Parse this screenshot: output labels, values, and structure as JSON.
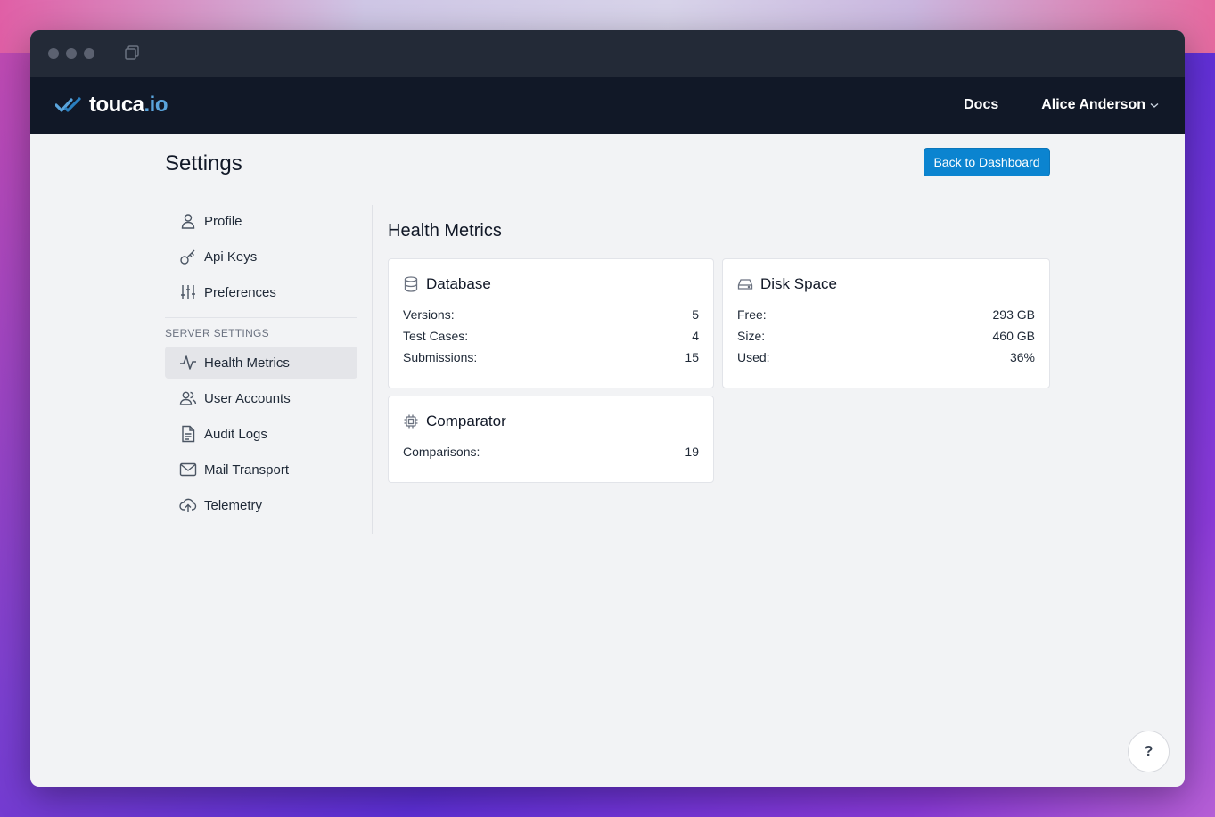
{
  "brand": {
    "name": "touca",
    "tld": ".io"
  },
  "nav": {
    "docs": "Docs",
    "user": "Alice Anderson"
  },
  "page": {
    "title": "Settings",
    "back_button": "Back to Dashboard"
  },
  "sidebar": {
    "personal": [
      {
        "label": "Profile",
        "icon": "user-icon"
      },
      {
        "label": "Api Keys",
        "icon": "key-icon"
      },
      {
        "label": "Preferences",
        "icon": "sliders-icon"
      }
    ],
    "server_heading": "Server Settings",
    "server": [
      {
        "label": "Health Metrics",
        "icon": "activity-icon"
      },
      {
        "label": "User Accounts",
        "icon": "users-icon"
      },
      {
        "label": "Audit Logs",
        "icon": "document-icon"
      },
      {
        "label": "Mail Transport",
        "icon": "mail-icon"
      },
      {
        "label": "Telemetry",
        "icon": "cloud-upload-icon"
      }
    ]
  },
  "main": {
    "title": "Health Metrics",
    "database": {
      "title": "Database",
      "rows": [
        {
          "label": "Versions:",
          "value": "5"
        },
        {
          "label": "Test Cases:",
          "value": "4"
        },
        {
          "label": "Submissions:",
          "value": "15"
        }
      ]
    },
    "disk": {
      "title": "Disk Space",
      "rows": [
        {
          "label": "Free:",
          "value": "293 GB"
        },
        {
          "label": "Size:",
          "value": "460 GB"
        },
        {
          "label": "Used:",
          "value": "36%"
        }
      ]
    },
    "comparator": {
      "title": "Comparator",
      "rows": [
        {
          "label": "Comparisons:",
          "value": "19"
        }
      ]
    }
  },
  "help": "?",
  "colors": {
    "accent": "#0b84d0",
    "navbar": "#111827",
    "titlebar": "#232a37",
    "brand_tld": "#5aa4dc"
  }
}
